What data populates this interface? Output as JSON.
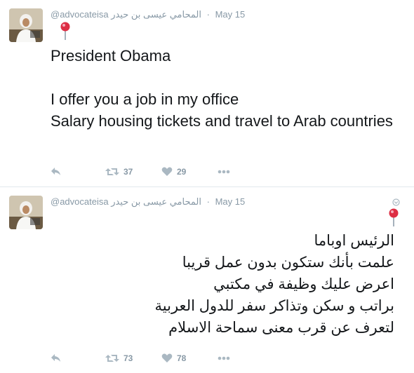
{
  "tweets": [
    {
      "handle": "@advocateisa",
      "display_name": "المحامي عيسى بن حيدر",
      "separator": "·",
      "date": "May 15",
      "text": "President Obama\n\nI offer you a job in my office\nSalary housing tickets and travel to Arab countries",
      "retweets": "37",
      "likes": "29"
    },
    {
      "handle": "@advocateisa",
      "display_name": "المحامي عيسى بن حيدر",
      "separator": "·",
      "date": "May 15",
      "text": "الرئيس اوباما\nعلمت بأنك ستكون بدون عمل قريبا\nاعرض عليك وظيفة في مكتبي\nبراتب و سكن وتذاكر سفر للدول العربية\nلتعرف عن قرب معنى سماحة الاسلام",
      "retweets": "73",
      "likes": "78"
    }
  ],
  "icons": {
    "reply": "reply-icon",
    "retweet": "retweet-icon",
    "like": "heart-icon",
    "more": "more-icon",
    "pin": "round-pushpin-icon",
    "caret": "caret-down-icon"
  },
  "colors": {
    "meta_text": "#8899a6",
    "body_text": "#14171a",
    "pin_red": "#dd2e44",
    "divider": "#e1e8ed"
  }
}
